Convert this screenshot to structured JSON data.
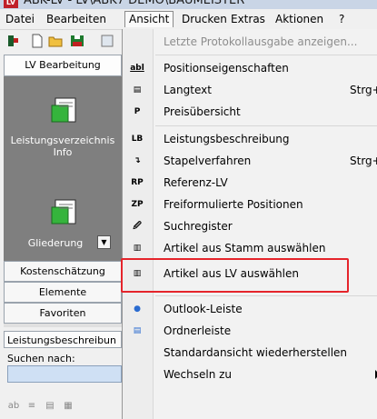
{
  "window": {
    "title": "ABK-LV - LV\\ABK7 DEMO\\BAUMEISTER",
    "app_icon": "LV"
  },
  "menubar": {
    "items": [
      {
        "label": "Datei",
        "key": "datei"
      },
      {
        "label": "Bearbeiten",
        "key": "bearbeiten"
      },
      {
        "label": "Ansicht",
        "key": "ansicht",
        "active": true
      },
      {
        "label": "Drucken",
        "key": "drucken"
      },
      {
        "label": "Extras",
        "key": "extras"
      },
      {
        "label": "Aktionen",
        "key": "aktionen"
      },
      {
        "label": "?",
        "key": "help"
      }
    ]
  },
  "toolbar": {
    "icons": [
      "pin-icon",
      "new-document-icon",
      "open-folder-icon",
      "save-icon"
    ]
  },
  "left_panel": {
    "header": "LV Bearbeitung",
    "item_a_label": "Leistungsverzeichnis Info",
    "item_b_label": "Gliederung",
    "buttons": [
      "Kostenschätzung",
      "Elemente",
      "Favoriten"
    ],
    "lower_tab": "Leistungsbeschreibun",
    "search_label": "Suchen nach:",
    "search_value": ""
  },
  "dropdown": {
    "items": [
      {
        "icon": "protocol-icon",
        "icon_text": "",
        "label": "Letzte Protokollausgabe anzeigen...",
        "shortcut": "",
        "disabled": true
      },
      {
        "icon": "properties-icon",
        "icon_text": "abl",
        "label": "Positionseigenschaften",
        "shortcut": ""
      },
      {
        "icon": "longtext-icon",
        "icon_text": "▤",
        "label": "Langtext",
        "shortcut": "Strg+T"
      },
      {
        "icon": "price-icon",
        "icon_text": "P",
        "label": "Preisübersicht",
        "shortcut": ""
      },
      {
        "icon": "lb-icon",
        "icon_text": "LB",
        "label": "Leistungsbeschreibung",
        "shortcut": ""
      },
      {
        "icon": "batch-icon",
        "icon_text": "↴",
        "label": "Stapelverfahren",
        "shortcut": "Strg+S"
      },
      {
        "icon": "rp-icon",
        "icon_text": "RP",
        "label": "Referenz-LV",
        "shortcut": ""
      },
      {
        "icon": "zp-icon",
        "icon_text": "ZP",
        "label": "Freiformulierte Positionen",
        "shortcut": ""
      },
      {
        "icon": "search-register-icon",
        "icon_text": "🖉",
        "label": "Suchregister",
        "shortcut": ""
      },
      {
        "icon": "article-stamm-icon",
        "icon_text": "▥",
        "label": "Artikel aus Stamm auswählen",
        "shortcut": ""
      },
      {
        "icon": "article-lv-icon",
        "icon_text": "▥",
        "label": "Artikel aus LV auswählen",
        "shortcut": "",
        "highlighted": true
      },
      {
        "icon": "outlook-bar-icon",
        "icon_text": "●",
        "label": "Outlook-Leiste",
        "shortcut": ""
      },
      {
        "icon": "folder-bar-icon",
        "icon_text": "▤",
        "label": "Ordnerleiste",
        "shortcut": ""
      },
      {
        "icon": "",
        "icon_text": "",
        "label": "Standardansicht wiederherstellen",
        "shortcut": ""
      },
      {
        "icon": "",
        "icon_text": "",
        "label": "Wechseln zu",
        "shortcut": "",
        "submenu": true
      }
    ]
  },
  "colors": {
    "highlight_border": "#e5242b",
    "panel_dark": "#7f7f7f",
    "search_bg": "#cfe0f4"
  }
}
